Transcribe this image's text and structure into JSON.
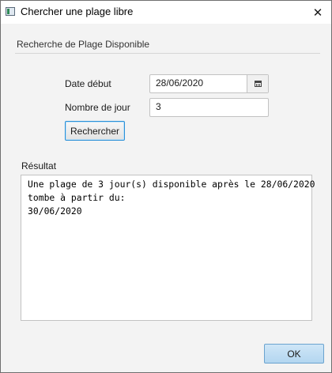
{
  "window": {
    "title": "Chercher une plage libre",
    "close_glyph": "✕",
    "app_icon": "app-icon"
  },
  "form": {
    "section_title": "Recherche de Plage Disponible",
    "date_label": "Date début",
    "date_value": "28/06/2020",
    "calendar_icon": "calendar-icon",
    "days_label": "Nombre de jour",
    "days_value": "3",
    "search_button": "Rechercher"
  },
  "result": {
    "label": "Résultat",
    "lines": [
      "Une plage de 3 jour(s) disponible après le 28/06/2020",
      "tombe à partir du:",
      "30/06/2020"
    ]
  },
  "footer": {
    "ok_button": "OK"
  }
}
